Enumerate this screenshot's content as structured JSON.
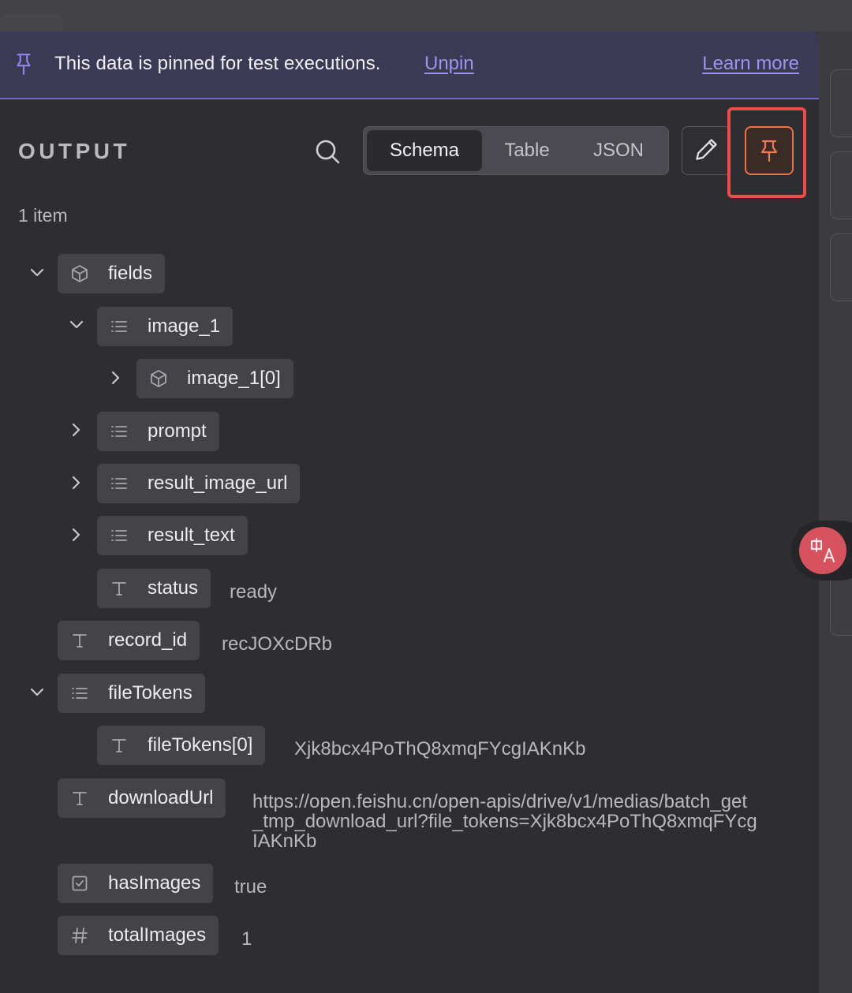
{
  "banner": {
    "message": "This data is pinned for test executions.",
    "unpin_label": "Unpin",
    "learn_more_label": "Learn more"
  },
  "output": {
    "title": "OUTPUT",
    "tabs": [
      "Schema",
      "Table",
      "JSON"
    ],
    "active_tab": "Schema",
    "item_count": "1 item"
  },
  "tree": [
    {
      "name": "fields",
      "type": "object",
      "expanded": true,
      "value": ""
    },
    {
      "name": "image_1",
      "type": "array",
      "expanded": true,
      "value": ""
    },
    {
      "name": "image_1[0]",
      "type": "object",
      "expanded": false,
      "value": ""
    },
    {
      "name": "prompt",
      "type": "array",
      "expanded": false,
      "value": ""
    },
    {
      "name": "result_image_url",
      "type": "array",
      "expanded": false,
      "value": ""
    },
    {
      "name": "result_text",
      "type": "array",
      "expanded": false,
      "value": ""
    },
    {
      "name": "status",
      "type": "string",
      "value": "ready"
    },
    {
      "name": "record_id",
      "type": "string",
      "value": "recJOXcDRb"
    },
    {
      "name": "fileTokens",
      "type": "array",
      "expanded": true,
      "value": ""
    },
    {
      "name": "fileTokens[0]",
      "type": "string",
      "value": "Xjk8bcx4PoThQ8xmqFYcgIAKnKb"
    },
    {
      "name": "downloadUrl",
      "type": "string",
      "value": "https://open.feishu.cn/open-apis/drive/v1/medias/batch_get_tmp_download_url?file_tokens=Xjk8bcx4PoThQ8xmqFYcgIAKnKb"
    },
    {
      "name": "hasImages",
      "type": "boolean",
      "value": "true"
    },
    {
      "name": "totalImages",
      "type": "number",
      "value": "1"
    }
  ],
  "colors": {
    "accent": "#9c95f0",
    "banner_bg": "#3c3954",
    "panel_bg": "#2e2e31",
    "pin_active": "#e6734e",
    "highlight_box": "#ef4b4b"
  }
}
